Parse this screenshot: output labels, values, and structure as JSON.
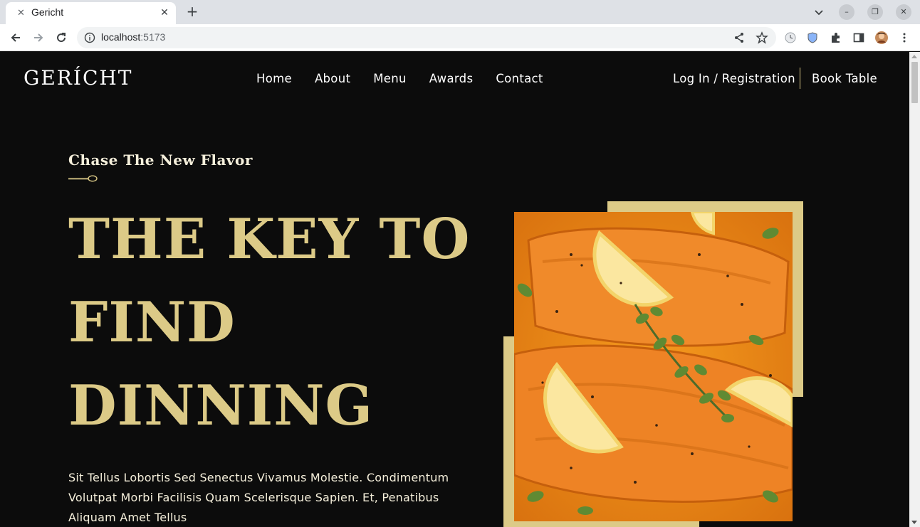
{
  "browser": {
    "tab_title": "Gericht",
    "url_host": "localhost",
    "url_port": ":5173"
  },
  "site": {
    "logo": "GERÍCHT",
    "nav": [
      "Home",
      "About",
      "Menu",
      "Awards",
      "Contact"
    ],
    "login": "Log In / Registration",
    "book": "Book Table"
  },
  "hero": {
    "subtitle": "Chase The New Flavor",
    "headline": [
      "THE KEY TO",
      "FIND",
      "DINNING"
    ],
    "description": "Sit Tellus Lobortis Sed Senectus Vivamus Molestie. Condimentum Volutpat Morbi Facilisis Quam Scelerisque Sapien. Et, Penatibus Aliquam Amet Tellus",
    "image_icon": "salmon-dish-photo"
  },
  "colors": {
    "background": "#0c0c0c",
    "gold": "#dcca87",
    "cream": "#f5efdb",
    "white": "#ffffff"
  }
}
